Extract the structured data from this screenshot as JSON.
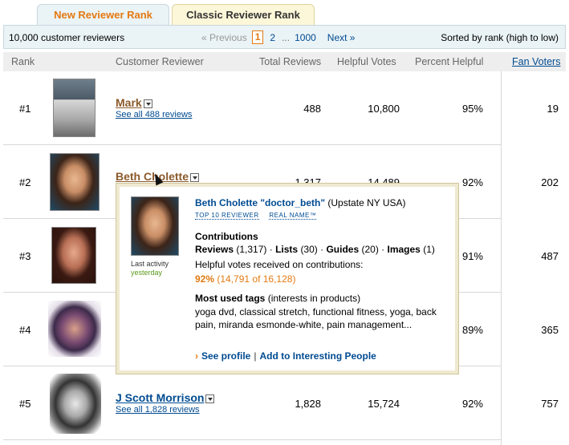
{
  "tabs": {
    "new_label": "New Reviewer Rank",
    "classic_label": "Classic Reviewer Rank"
  },
  "topbar": {
    "count": "10,000 customer reviewers",
    "prev": "« Previous",
    "current_page": "1",
    "page2": "2",
    "dots": "...",
    "page_last": "1000",
    "next": "Next »",
    "sort": "Sorted by rank (high to low)"
  },
  "header": {
    "rank": "Rank",
    "reviewer": "Customer Reviewer",
    "total": "Total Reviews",
    "helpful": "Helpful Votes",
    "percent": "Percent Helpful",
    "fan": "Fan Voters"
  },
  "rows": [
    {
      "rank": "#1",
      "name": "Mark",
      "see_all": "See all 488 reviews",
      "total": "488",
      "helpful": "10,800",
      "percent": "95%",
      "fans": "19"
    },
    {
      "rank": "#2",
      "name": "Beth Cholette",
      "see_all": "",
      "total": "1,317",
      "helpful": "14,489",
      "percent": "92%",
      "fans": "202"
    },
    {
      "rank": "#3",
      "name": "",
      "see_all": "",
      "total": "",
      "helpful": "",
      "percent": "91%",
      "fans": "487"
    },
    {
      "rank": "#4",
      "name": "",
      "see_all": "",
      "total": "",
      "helpful": "",
      "percent": "89%",
      "fans": "365"
    },
    {
      "rank": "#5",
      "name": "J Scott Morrison",
      "see_all": "See all 1,828 reviews",
      "total": "1,828",
      "helpful": "15,724",
      "percent": "92%",
      "fans": "757"
    }
  ],
  "popover": {
    "name": "Beth Cholette \"doctor_beth\"",
    "location": "(Upstate NY USA)",
    "badge1": "TOP 10 REVIEWER",
    "badge2": "REAL NAME™",
    "last_activity": "Last activity",
    "last_when": "yesterday",
    "contributions_heading": "Contributions",
    "reviews_label": "Reviews",
    "reviews_count": "(1,317)",
    "lists_label": "Lists",
    "lists_count": "(30)",
    "guides_label": "Guides",
    "guides_count": "(20)",
    "images_label": "Images",
    "images_count": "(1)",
    "helpful_text": "Helpful votes received on contributions:",
    "helpful_pct": "92%",
    "helpful_detail": "(14,791 of 16,128)",
    "tags_heading": "Most used tags",
    "tags_sub": "(interests in products)",
    "tags": "yoga dvd, classical stretch, functional fitness, yoga, back pain, miranda esmonde-white, pain management...",
    "see_profile": "See profile",
    "separator": "|",
    "add_interesting": "Add to Interesting People"
  }
}
